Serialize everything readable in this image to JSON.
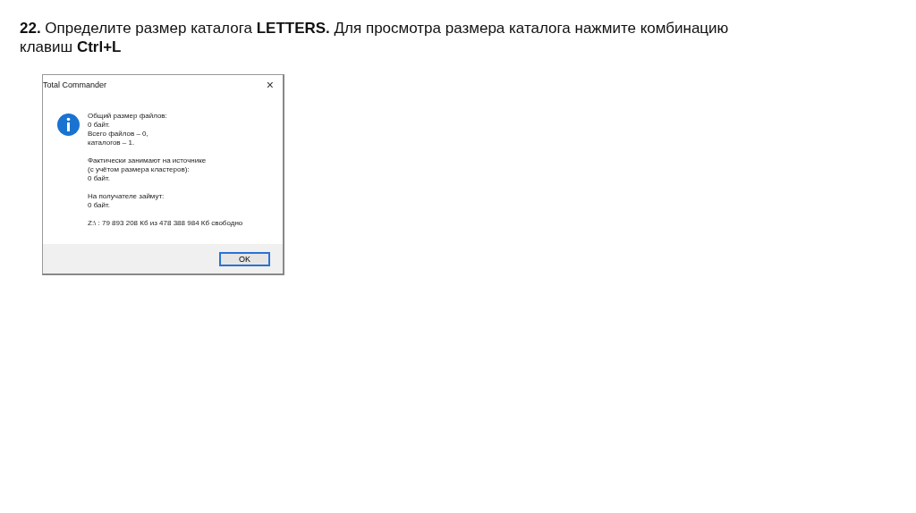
{
  "heading": "**22.** Определите размер каталога **LETTERS.** Для просмотра размера каталога нажмите комбинацию клавиш **Ctrl+L**",
  "dialog": {
    "title": "Total Commander",
    "close": "×",
    "paragraphs": [
      [
        "Общий размер файлов:",
        "0 байт.",
        "Всего файлов – 0,",
        "каталогов – 1."
      ],
      [
        "Фактически занимают на источнике",
        "(с учётом размера кластеров):",
        "0 байт."
      ],
      [
        "На получателе займут:",
        "0 байт."
      ],
      [
        "Z:\\ :  79 893 208 Кб из 478 388 984 Кб свободно"
      ]
    ],
    "button": "OK"
  }
}
